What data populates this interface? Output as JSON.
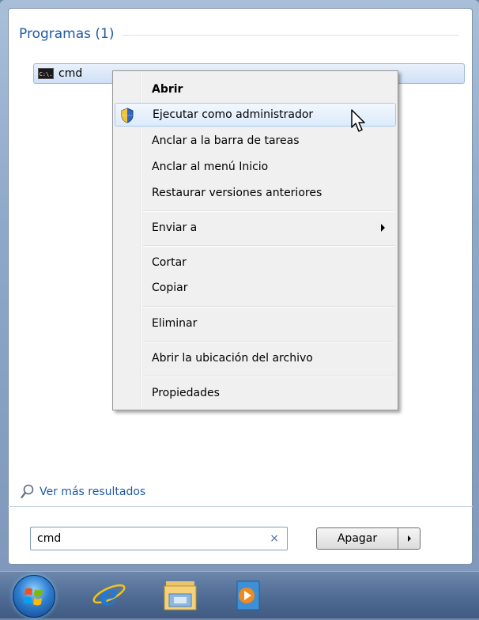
{
  "results": {
    "section_title": "Programas (1)",
    "program": {
      "label": "cmd",
      "icon": "cmd-icon",
      "icon_text": "C:\\."
    }
  },
  "context_menu": {
    "items": [
      {
        "label": "Abrir",
        "bold": true
      },
      {
        "label": "Ejecutar como administrador",
        "icon": "shield-icon",
        "hovered": true
      },
      {
        "label": "Anclar a la barra de tareas"
      },
      {
        "label": "Anclar al menú Inicio"
      },
      {
        "label": "Restaurar versiones anteriores"
      },
      {
        "label": "Enviar a",
        "submenu": true
      },
      {
        "label": "Cortar"
      },
      {
        "label": "Copiar"
      },
      {
        "label": "Eliminar"
      },
      {
        "label": "Abrir la ubicación del archivo"
      },
      {
        "label": "Propiedades"
      }
    ]
  },
  "see_more": {
    "label": "Ver más resultados",
    "icon": "magnifier-icon"
  },
  "search": {
    "value": "cmd",
    "clear_icon": "×"
  },
  "shutdown": {
    "label": "Apagar",
    "arrow_icon": "chevron-right-icon"
  },
  "taskbar": {
    "items": [
      {
        "name": "start-orb",
        "icon": "windows-logo-icon"
      },
      {
        "name": "internet-explorer",
        "icon": "internet-explorer-icon"
      },
      {
        "name": "windows-explorer",
        "icon": "folder-icon"
      },
      {
        "name": "media-player",
        "icon": "media-player-icon"
      }
    ]
  },
  "colors": {
    "accent": "#1e5aa6",
    "hover_fill": "#dcebfc",
    "taskbar": "#4f6b94"
  }
}
